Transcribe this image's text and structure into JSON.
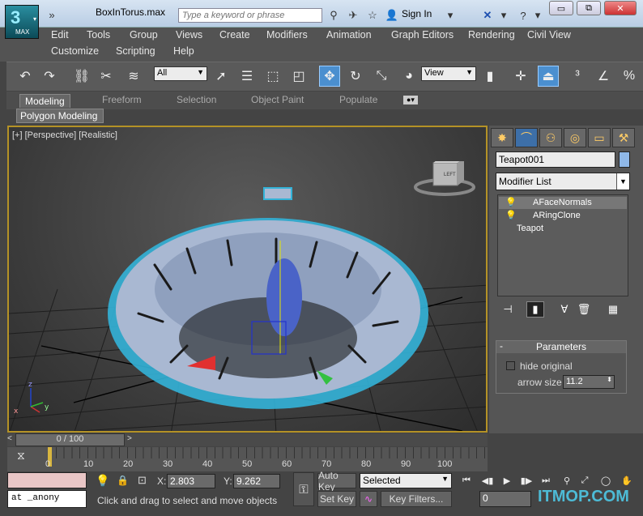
{
  "window": {
    "title": "BoxInTorus.max",
    "app_logo_label": "MAX",
    "search_placeholder": "Type a keyword or phrase",
    "sign_in": "Sign In",
    "controls": {
      "minimize": "▭",
      "restore": "⧉",
      "close": "✕"
    }
  },
  "menu": {
    "row1": [
      "Edit",
      "Tools",
      "Group",
      "Views",
      "Create",
      "Modifiers",
      "Animation",
      "Graph Editors",
      "Rendering",
      "Civil View"
    ],
    "row2": [
      "Customize",
      "Scripting",
      "Help"
    ]
  },
  "toolbar": {
    "selection_filter": "All",
    "reference_coord": "View"
  },
  "ribbon": {
    "tabs": [
      "Modeling",
      "Freeform",
      "Selection",
      "Object Paint",
      "Populate"
    ],
    "active_tab": "Modeling",
    "panel": "Polygon Modeling"
  },
  "viewport": {
    "label": "[+] [Perspective] [Realistic]",
    "viewcube_face": "LEFT"
  },
  "command_panel": {
    "object_name": "Teapot001",
    "object_color": "#8fb8e8",
    "modifier_list": "Modifier List",
    "stack": [
      "AFaceNormals",
      "ARingClone",
      "Teapot"
    ],
    "rollout_title": "Parameters",
    "hide_original_label": "hide original",
    "hide_original_checked": false,
    "arrow_size_label": "arrow size",
    "arrow_size_value": "11.2"
  },
  "timeline": {
    "slider_label": "0 / 100",
    "ticks": [
      "0",
      "10",
      "20",
      "30",
      "40",
      "50",
      "60",
      "70",
      "80",
      "90",
      "100"
    ]
  },
  "status": {
    "maxscript_text": "at _anony",
    "x_label": "X:",
    "x_value": "2.803",
    "y_label": "Y:",
    "y_value": "9.262",
    "prompt": "Click and drag to select and move objects",
    "auto_key": "Auto Key",
    "set_key": "Set Key",
    "selected": "Selected",
    "key_filters": "Key Filters...",
    "frame": "0",
    "watermark": "ITMOP.COM"
  }
}
